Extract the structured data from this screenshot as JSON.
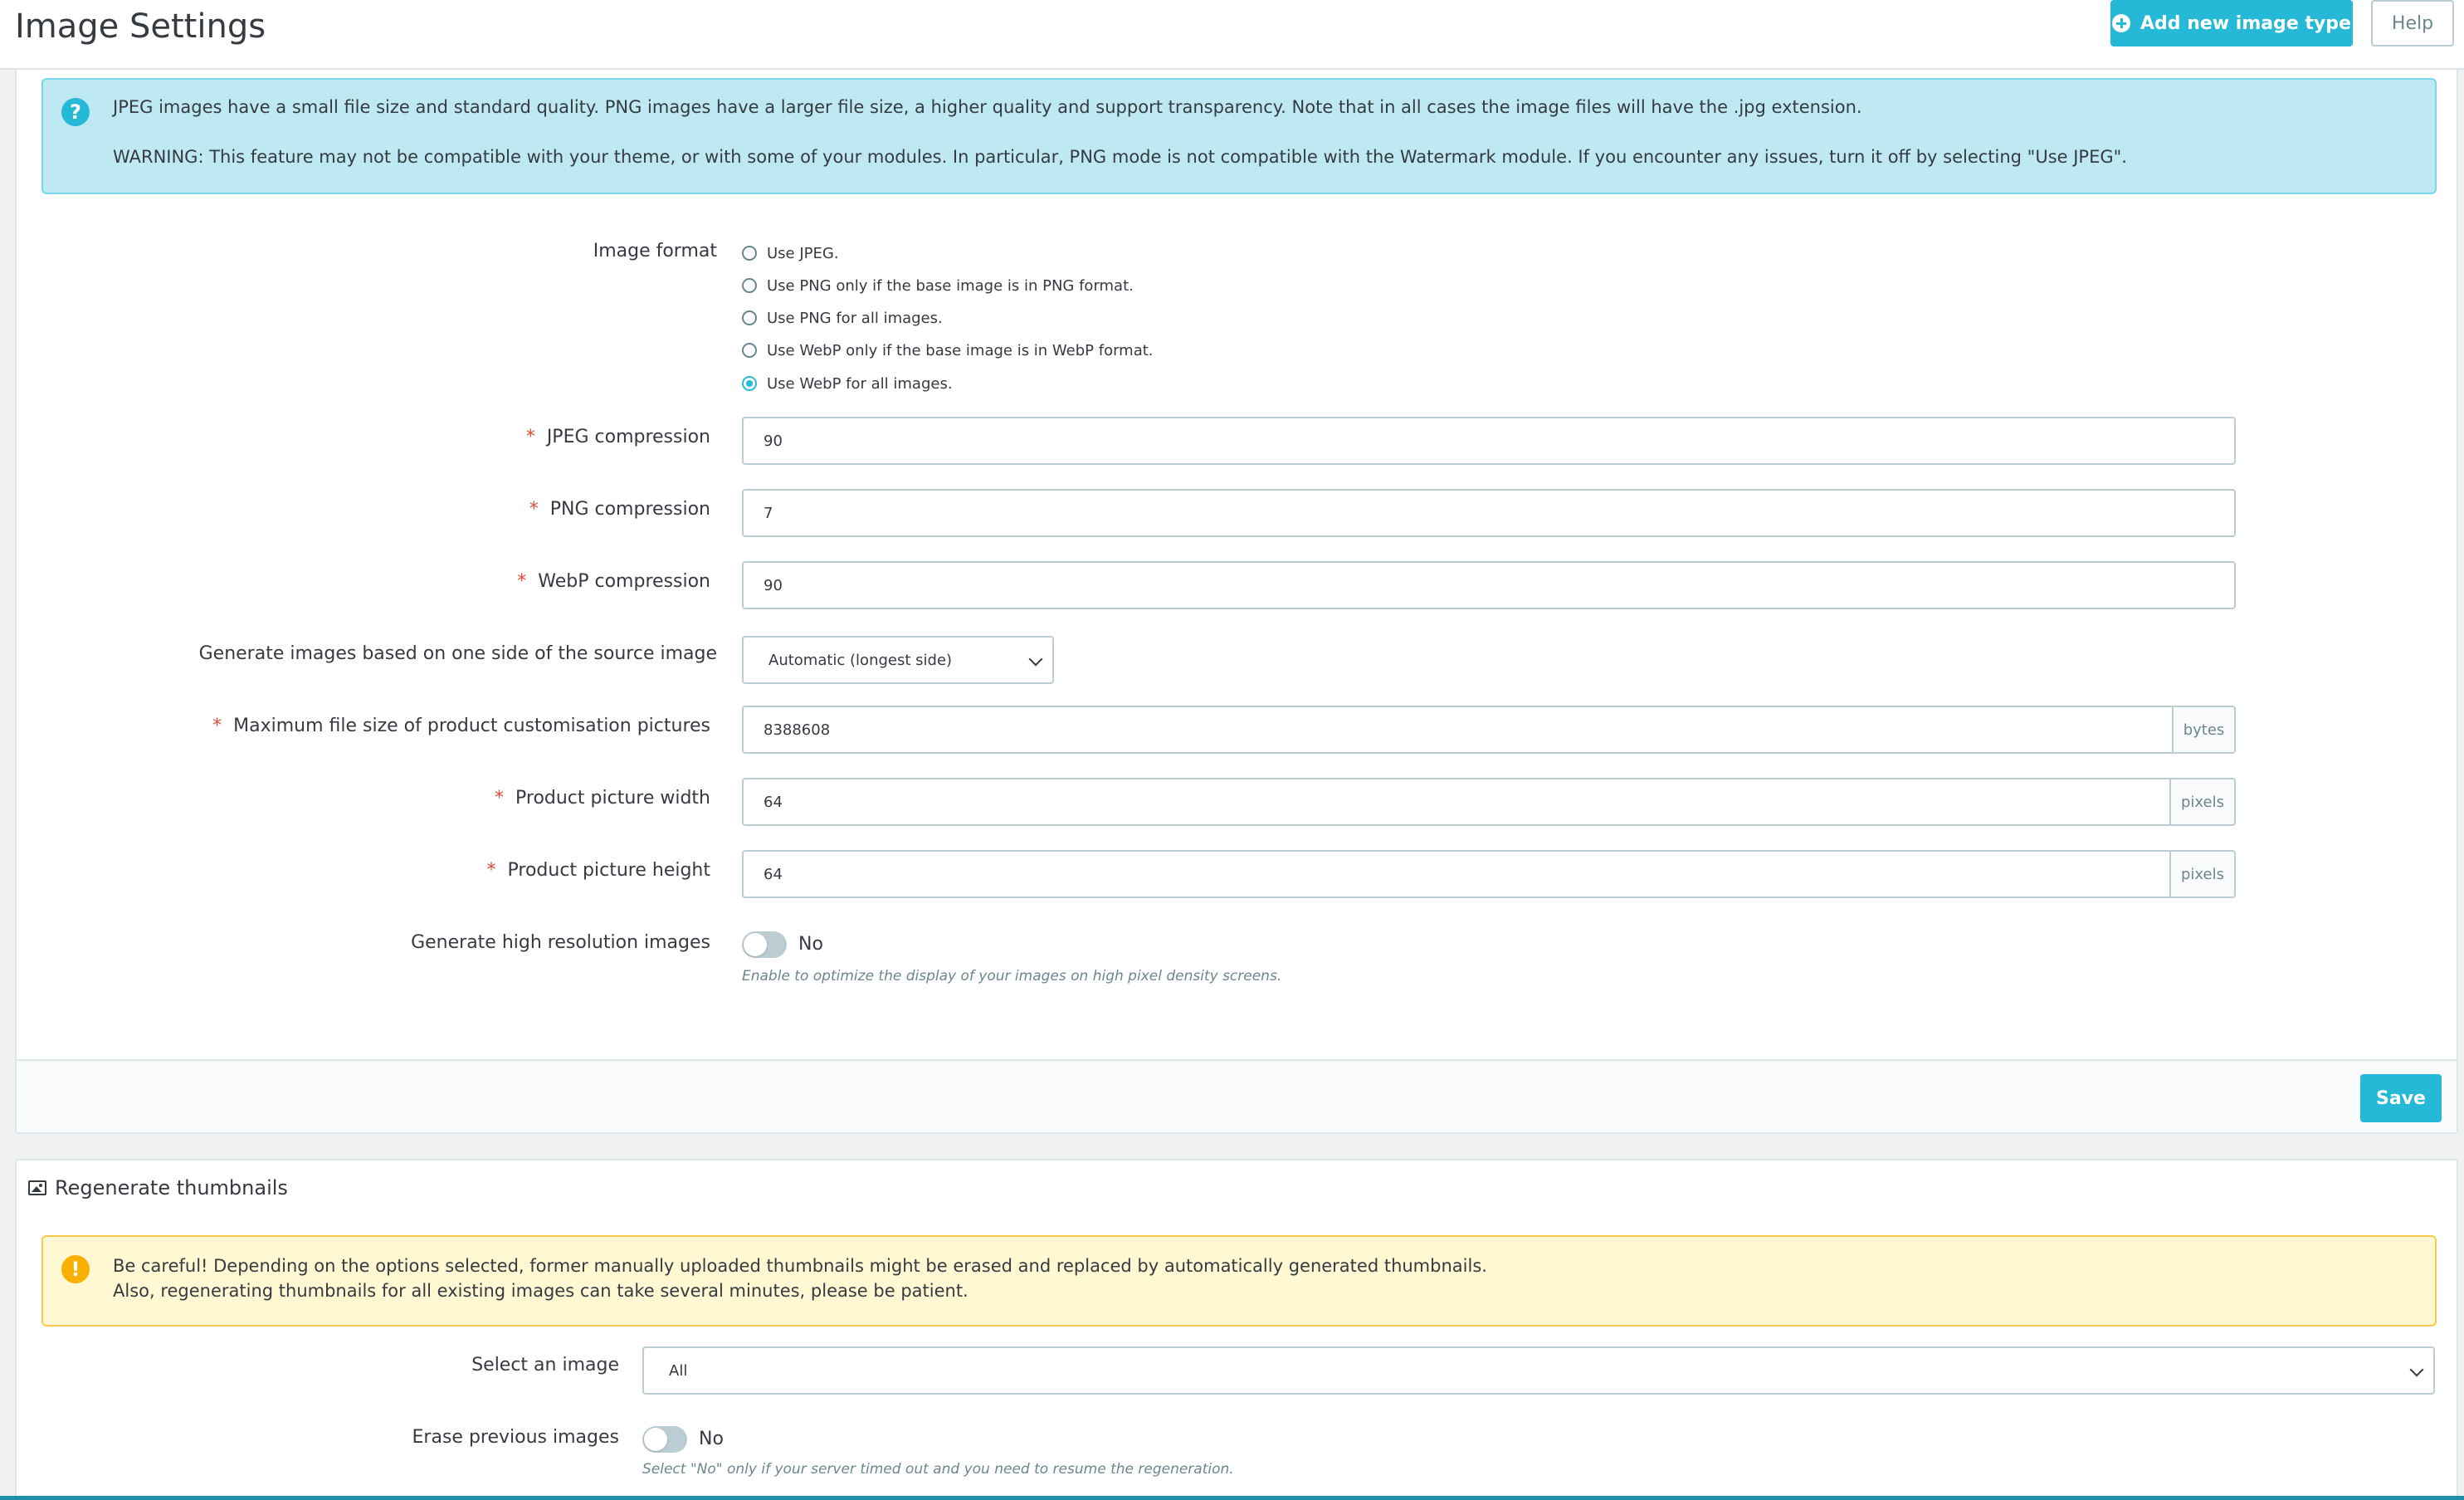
{
  "header": {
    "title": "Image Settings",
    "add_button": "Add new image type",
    "help_button": "Help"
  },
  "info_alert": {
    "line1": "JPEG images have a small file size and standard quality. PNG images have a larger file size, a higher quality and support transparency. Note that in all cases the image files will have the .jpg extension.",
    "line2": "WARNING: This feature may not be compatible with your theme, or with some of your modules. In particular, PNG mode is not compatible with the Watermark module. If you encounter any issues, turn it off by selecting \"Use JPEG\"."
  },
  "form": {
    "image_format": {
      "label": "Image format",
      "options": [
        {
          "label": "Use JPEG.",
          "checked": false
        },
        {
          "label": "Use PNG only if the base image is in PNG format.",
          "checked": false
        },
        {
          "label": "Use PNG for all images.",
          "checked": false
        },
        {
          "label": "Use WebP only if the base image is in WebP format.",
          "checked": false
        },
        {
          "label": "Use WebP for all images.",
          "checked": true
        }
      ]
    },
    "jpeg_compression": {
      "label": "JPEG compression",
      "value": "90"
    },
    "png_compression": {
      "label": "PNG compression",
      "value": "7"
    },
    "webp_compression": {
      "label": "WebP compression",
      "value": "90"
    },
    "generate_side": {
      "label": "Generate images based on one side of the source image",
      "value": "Automatic (longest side)"
    },
    "max_file_size": {
      "label": "Maximum file size of product customisation pictures",
      "value": "8388608",
      "unit": "bytes"
    },
    "picture_width": {
      "label": "Product picture width",
      "value": "64",
      "unit": "pixels"
    },
    "picture_height": {
      "label": "Product picture height",
      "value": "64",
      "unit": "pixels"
    },
    "high_resolution": {
      "label": "Generate high resolution images",
      "state": "No",
      "help": "Enable to optimize the display of your images on high pixel density screens."
    },
    "save_button": "Save"
  },
  "regenerate": {
    "title": "Regenerate thumbnails",
    "warning_line1": "Be careful! Depending on the options selected, former manually uploaded thumbnails might be erased and replaced by automatically generated thumbnails.",
    "warning_line2": "Also, regenerating thumbnails for all existing images can take several minutes, please be patient.",
    "select_image": {
      "label": "Select an image",
      "value": "All"
    },
    "erase_previous": {
      "label": "Erase previous images",
      "state": "No",
      "help": "Select \"No\" only if your server timed out and you need to resume the regeneration."
    }
  },
  "colors": {
    "primary": "#25b9d7",
    "info_bg": "#bee9f3",
    "warning_bg": "#fff8d2",
    "required": "#e14a35"
  }
}
